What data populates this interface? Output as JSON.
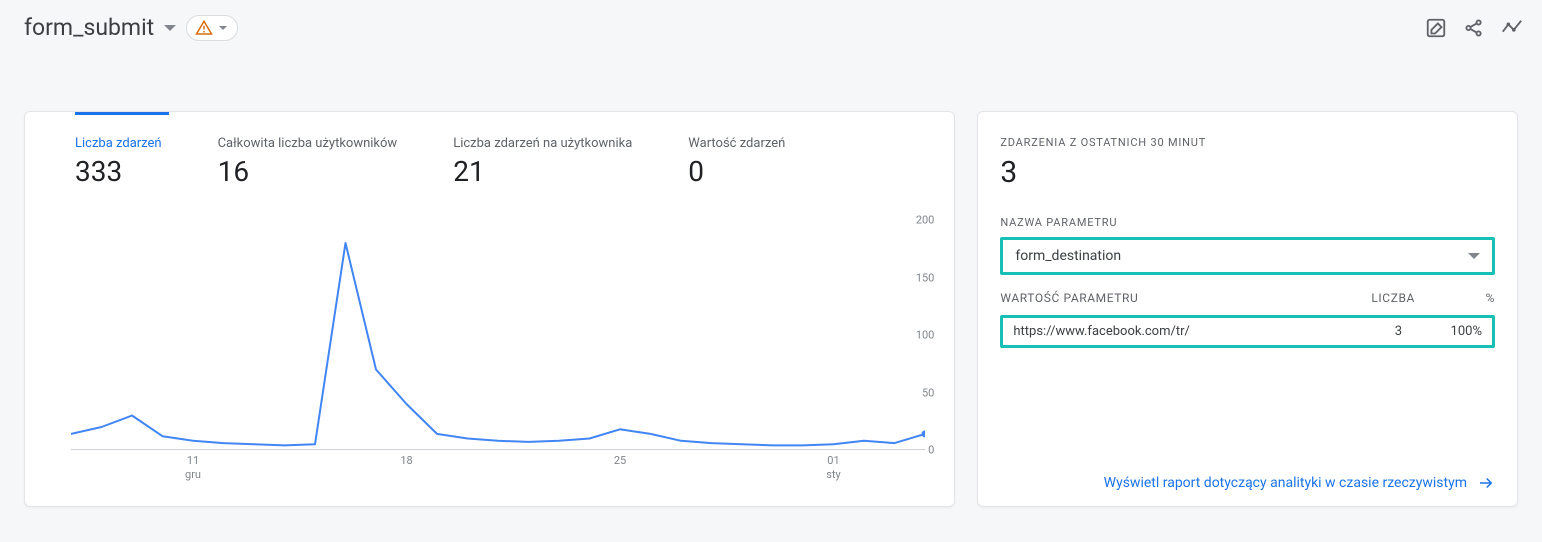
{
  "header": {
    "title": "form_submit"
  },
  "metrics": [
    {
      "label": "Liczba zdarzeń",
      "value": "333",
      "active": true
    },
    {
      "label": "Całkowita liczba użytkowników",
      "value": "16",
      "active": false
    },
    {
      "label": "Liczba zdarzeń na użytkownika",
      "value": "21",
      "active": false
    },
    {
      "label": "Wartość zdarzeń",
      "value": "0",
      "active": false
    }
  ],
  "param_panel": {
    "realtime_title": "ZDARZENIA Z OSTATNICH 30 MINUT",
    "realtime_count": "3",
    "param_name_label": "NAZWA PARAMETRU",
    "param_name_value": "form_destination",
    "col_value": "WARTOŚĆ PARAMETRU",
    "col_count": "LICZBA",
    "col_pct": "%",
    "rows": [
      {
        "value": "https://www.facebook.com/tr/",
        "count": "3",
        "pct": "100%"
      }
    ],
    "realtime_link": "Wyświetl raport dotyczący analityki w czasie rzeczywistym"
  },
  "chart_data": {
    "type": "line",
    "title": "",
    "xlabel": "",
    "ylabel": "",
    "ylim": [
      0,
      200
    ],
    "y_ticks": [
      0,
      50,
      100,
      150,
      200
    ],
    "x_ticks": [
      {
        "pos": 4,
        "day": "11",
        "month": "gru"
      },
      {
        "pos": 11,
        "day": "18",
        "month": ""
      },
      {
        "pos": 18,
        "day": "25",
        "month": ""
      },
      {
        "pos": 25,
        "day": "01",
        "month": "sty"
      }
    ],
    "n_points": 29,
    "values": [
      14,
      20,
      30,
      12,
      8,
      6,
      5,
      4,
      5,
      180,
      70,
      40,
      14,
      10,
      8,
      7,
      8,
      10,
      18,
      14,
      8,
      6,
      5,
      4,
      4,
      5,
      8,
      6,
      14
    ]
  }
}
